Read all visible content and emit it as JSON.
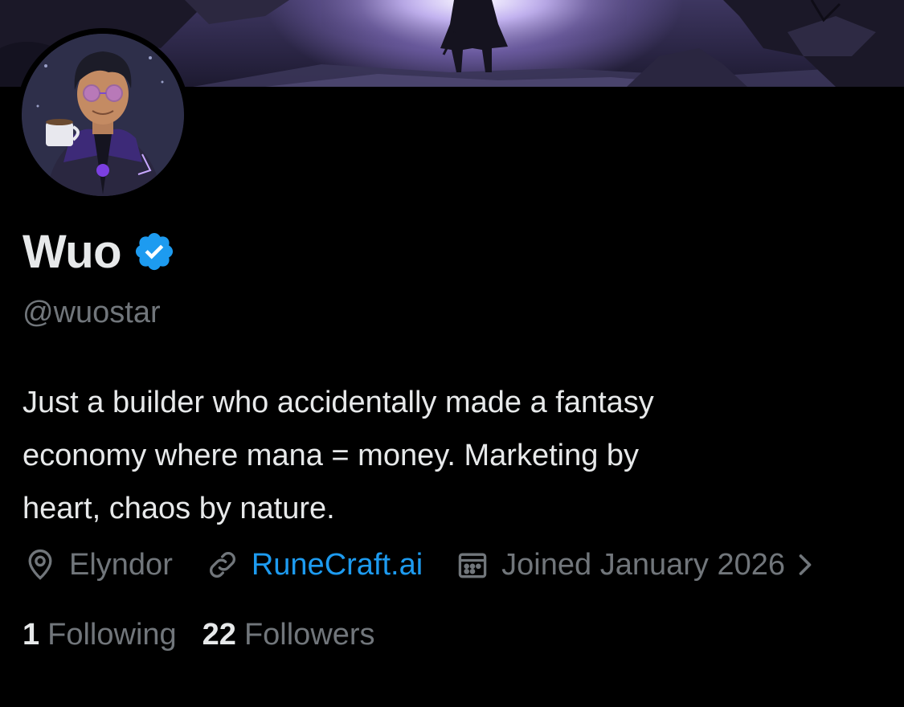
{
  "profile": {
    "display_name": "Wuo",
    "verified": true,
    "handle": "@wuostar",
    "bio_lines": [
      "Just a builder who accidentally made a fantasy",
      "economy where mana = money. Marketing by",
      "heart, chaos by nature."
    ],
    "location": "Elyndor",
    "website": "RuneCraft.ai",
    "joined": "Joined January 2026",
    "following_count": "1",
    "following_label": "Following",
    "followers_count": "22",
    "followers_label": "Followers"
  },
  "icons": {
    "verified": "verified-badge-icon",
    "location": "location-pin-icon",
    "link": "link-icon",
    "calendar": "calendar-icon",
    "chevron": "chevron-right-icon"
  },
  "colors": {
    "background": "#000000",
    "primary_text": "#e7e9ea",
    "secondary_text": "#71767b",
    "link": "#1d9bf0",
    "verified": "#1d9bf0"
  }
}
